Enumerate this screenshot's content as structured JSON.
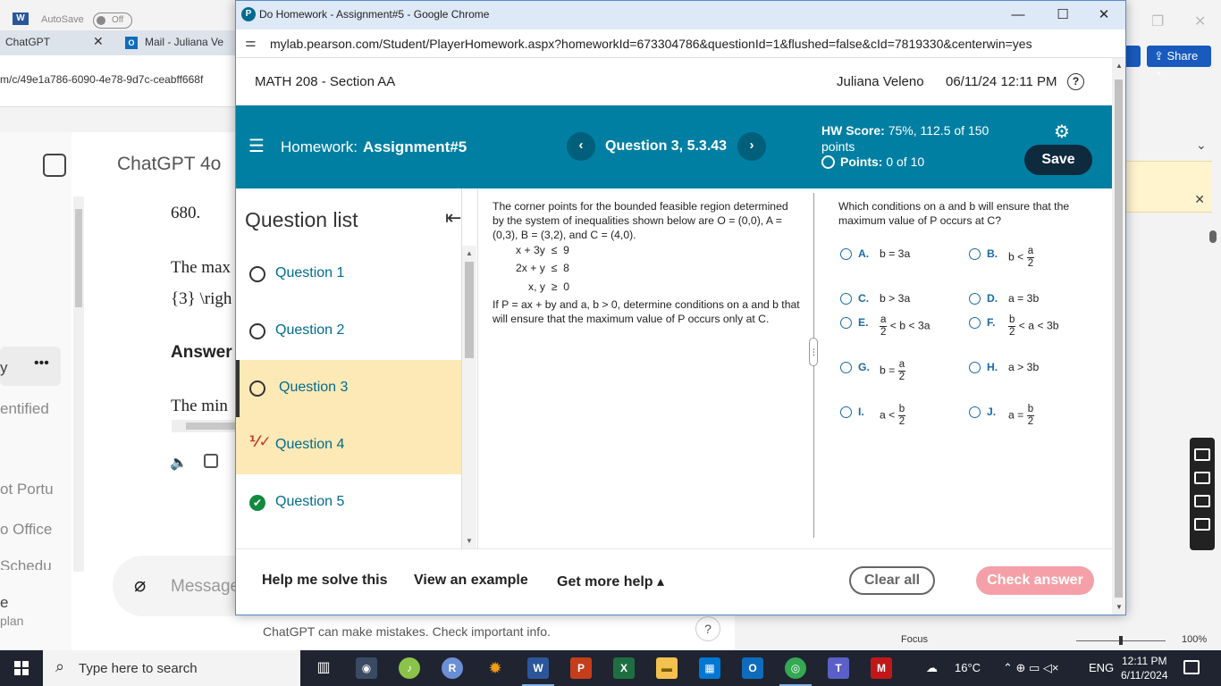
{
  "background": {
    "word": {
      "autosave_label": "AutoSave",
      "autosave_state": "Off",
      "share_label": "Share",
      "status_focus": "Focus",
      "zoom": "100%"
    },
    "browser_tabs": {
      "tab1": "ChatGPT",
      "tab2": "Mail - Juliana Ve",
      "url_fragment": "m/c/49e1a786-6090-4e78-9d7c-ceabff668f"
    },
    "chatgpt": {
      "title": "ChatGPT 4o",
      "line1": "680.",
      "line2": "The max",
      "line3": "{3} \\righ",
      "line4": "Answer",
      "line5": "The min",
      "side1": "y",
      "side2": "entified",
      "side3": "ot Portu",
      "side4": "o Office",
      "side5": "Schedu",
      "side6": "e",
      "side7": "plan",
      "message_placeholder": "Message",
      "disclaimer": "ChatGPT can make mistakes. Check important info.",
      "help": "?"
    }
  },
  "window": {
    "title": "Do Homework - Assignment#5 - Google Chrome",
    "url": "mylab.pearson.com/Student/PlayerHomework.aspx?homeworkId=673304786&questionId=1&flushed=false&cId=7819330&centerwin=yes"
  },
  "header": {
    "course": "MATH 208 - Section AA",
    "user": "Juliana Veleno",
    "datetime": "06/11/24 12:11 PM"
  },
  "hwbar": {
    "homework_label": "Homework:",
    "homework_name": "Assignment#5",
    "question_label": "Question 3, 5.3.43",
    "score_label": "HW Score:",
    "score_value": "75%, 112.5 of 150",
    "score_suffix": "points",
    "points_label": "Points:",
    "points_value": "0 of 10",
    "save_label": "Save"
  },
  "question_list": {
    "title": "Question list",
    "items": [
      {
        "label": "Question 1",
        "status": "unanswered"
      },
      {
        "label": "Question 2",
        "status": "unanswered"
      },
      {
        "label": "Question 3",
        "status": "current"
      },
      {
        "label": "Question 4",
        "status": "partial"
      },
      {
        "label": "Question 5",
        "status": "correct"
      }
    ]
  },
  "problem": {
    "intro": "The corner points for the bounded feasible region determined by the system of inequalities shown below are O = (0,0), A = (0,3), B = (3,2), and C = (4,0).",
    "ineq1": "x + 3y  ≤  9",
    "ineq2": "2x + y  ≤  8",
    "ineq3": "x, y  ≥  0",
    "prompt": "If P = ax + by and a, b > 0, determine conditions on a and b that will ensure that the maximum value of P occurs only at C."
  },
  "answer": {
    "question": "Which conditions on a and b will ensure that the maximum value of P occurs at C?",
    "options": {
      "A": {
        "letter": "A.",
        "expr": "b = 3a"
      },
      "B": {
        "letter": "B.",
        "pre": "b <",
        "num": "a",
        "den": "2"
      },
      "C": {
        "letter": "C.",
        "expr": "b > 3a"
      },
      "D": {
        "letter": "D.",
        "expr": "a = 3b"
      },
      "E": {
        "letter": "E.",
        "num": "a",
        "den": "2",
        "post": "< b < 3a"
      },
      "F": {
        "letter": "F.",
        "num": "b",
        "den": "2",
        "post": "< a < 3b"
      },
      "G": {
        "letter": "G.",
        "pre": "b =",
        "num": "a",
        "den": "2"
      },
      "H": {
        "letter": "H.",
        "expr": "a > 3b"
      },
      "I": {
        "letter": "I.",
        "pre": "a <",
        "num": "b",
        "den": "2"
      },
      "J": {
        "letter": "J.",
        "pre": "a =",
        "num": "b",
        "den": "2"
      }
    }
  },
  "footer": {
    "help_solve": "Help me solve this",
    "view_example": "View an example",
    "get_more_help": "Get more help ▴",
    "clear_all": "Clear all",
    "check_answer": "Check answer"
  },
  "taskbar": {
    "search_placeholder": "Type here to search",
    "weather": "16°C",
    "lang": "ENG",
    "time": "12:11 PM",
    "date": "6/11/2024"
  },
  "colors": {
    "hw_bar": "#007fa3",
    "save_button": "#0e2a3d",
    "check_answer": "#f5a0a8",
    "current_question": "#fde9b6",
    "link_blue": "#006b8f"
  }
}
